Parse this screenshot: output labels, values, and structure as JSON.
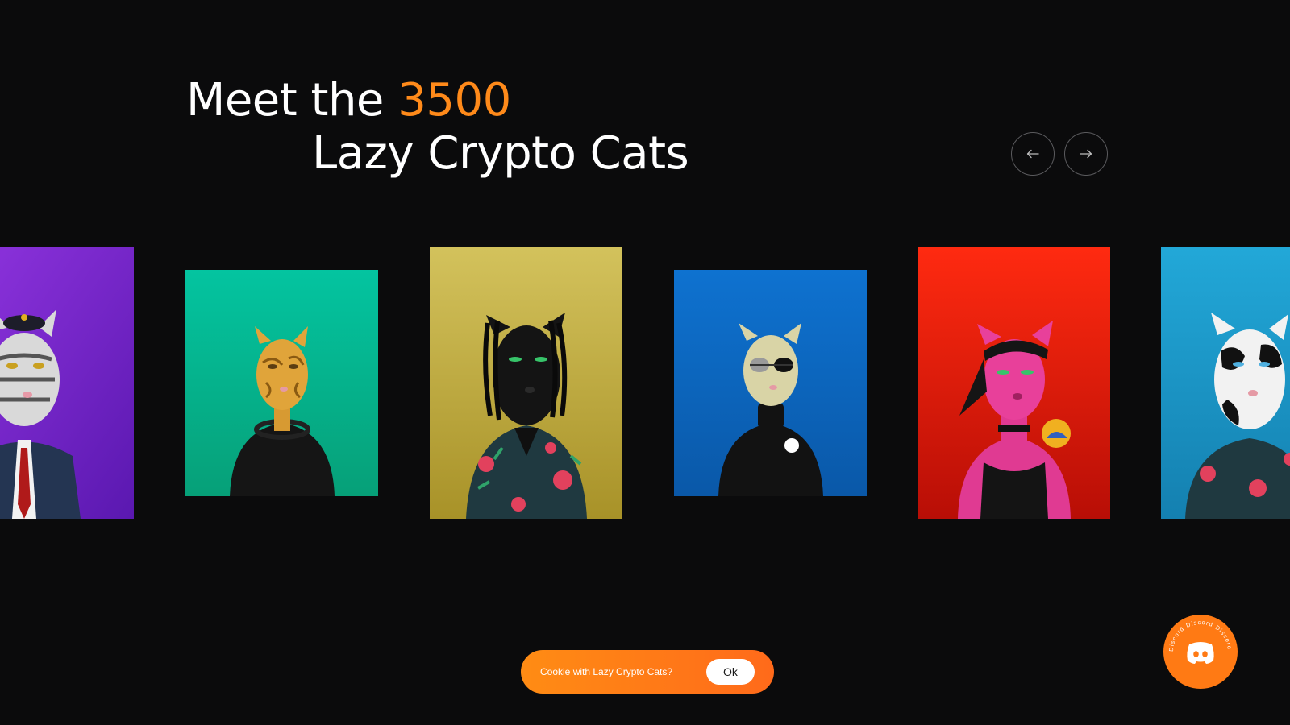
{
  "hero": {
    "title_prefix": "Meet the ",
    "title_count": "3500",
    "title_line2": "Lazy Crypto Cats"
  },
  "carousel": {
    "prev_label": "←",
    "next_label": "→",
    "cards": [
      {
        "name": "Tabby cat in suit and tie with captain hat",
        "bg": "#7b2fd0"
      },
      {
        "name": "Leopard-print cat with headphones",
        "bg": "#06b894"
      },
      {
        "name": "Black cat with dreadlocks and floral shirt",
        "bg": "#c8b548"
      },
      {
        "name": "Beige cat with eyepatch sunglasses and paw turtleneck",
        "bg": "#0c68c4"
      },
      {
        "name": "Pink cat with bandana and tank top",
        "bg": "#e51d0c"
      },
      {
        "name": "Cow-pattern cat with floral shirt",
        "bg": "#1c9ccc"
      }
    ]
  },
  "cookie": {
    "text": "Cookie with Lazy Crypto Cats?",
    "ok_label": "Ok"
  },
  "discord": {
    "ring_text": "Discord Discord Discord",
    "icon": "discord-icon"
  },
  "colors": {
    "background": "#0b0b0c",
    "accent": "#ff8a1a",
    "cookie_orange": "#ff7a14"
  }
}
